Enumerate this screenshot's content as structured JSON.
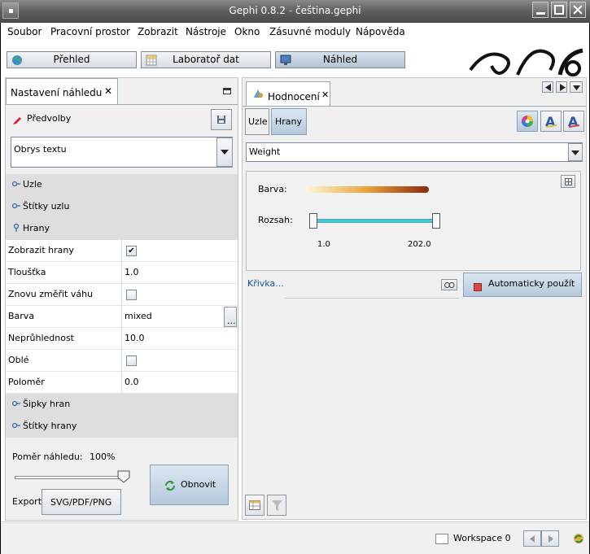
{
  "window": {
    "title": "Gephi 0.8.2 - čeština.gephi"
  },
  "menu": [
    "Soubor",
    "Pracovní prostor",
    "Zobrazit",
    "Nástroje",
    "Okno",
    "Zásuvné moduly",
    "Nápověda"
  ],
  "nav": {
    "overview": "Přehled",
    "data_lab": "Laboratoř dat",
    "preview": "Náhled"
  },
  "left_panel": {
    "tab_label": "Nastavení náhledu",
    "presets_label": "Předvolby",
    "preset_value": "Obrys textu",
    "sections": {
      "nodes": "Uzle",
      "node_labels": "Štítky uzlu",
      "edges": "Hrany",
      "edge_arrows": "Šipky hran",
      "edge_labels": "Štítky hrany"
    },
    "props": {
      "show_edges": {
        "label": "Zobrazit hrany",
        "checked": true
      },
      "thickness": {
        "label": "Tloušťka",
        "value": "1.0"
      },
      "rescale_weight": {
        "label": "Znovu změřit váhu",
        "checked": false
      },
      "color": {
        "label": "Barva",
        "value": "mixed",
        "button": "..."
      },
      "opacity": {
        "label": "Neprůhlednost",
        "value": "10.0"
      },
      "curved": {
        "label": "Oblé",
        "checked": false
      },
      "radius": {
        "label": "Poloměr",
        "value": "0.0"
      }
    },
    "ratio_label": "Poměr náhledu:",
    "ratio_value": "100%",
    "ratio_fraction": 1.0,
    "export_label": "Export:",
    "export_button": "SVG/PDF/PNG",
    "refresh_button": "Obnovit"
  },
  "right_panel": {
    "tab_label": "Hodnocení",
    "subtabs": {
      "nodes": "Uzle",
      "edges": "Hrany"
    },
    "attribute": "Weight",
    "color_label": "Barva:",
    "range_label": "Rozsah:",
    "range_min": "1.0",
    "range_max": "202.0",
    "curve_link": "Křivka...",
    "auto_apply": "Automaticky použít",
    "gradient": {
      "start": "#fff7d6",
      "mid": "#e9a23a",
      "end": "#8a2a0c"
    },
    "slider_color": "#3ec8e8"
  },
  "status": {
    "workspace": "Workspace 0"
  }
}
